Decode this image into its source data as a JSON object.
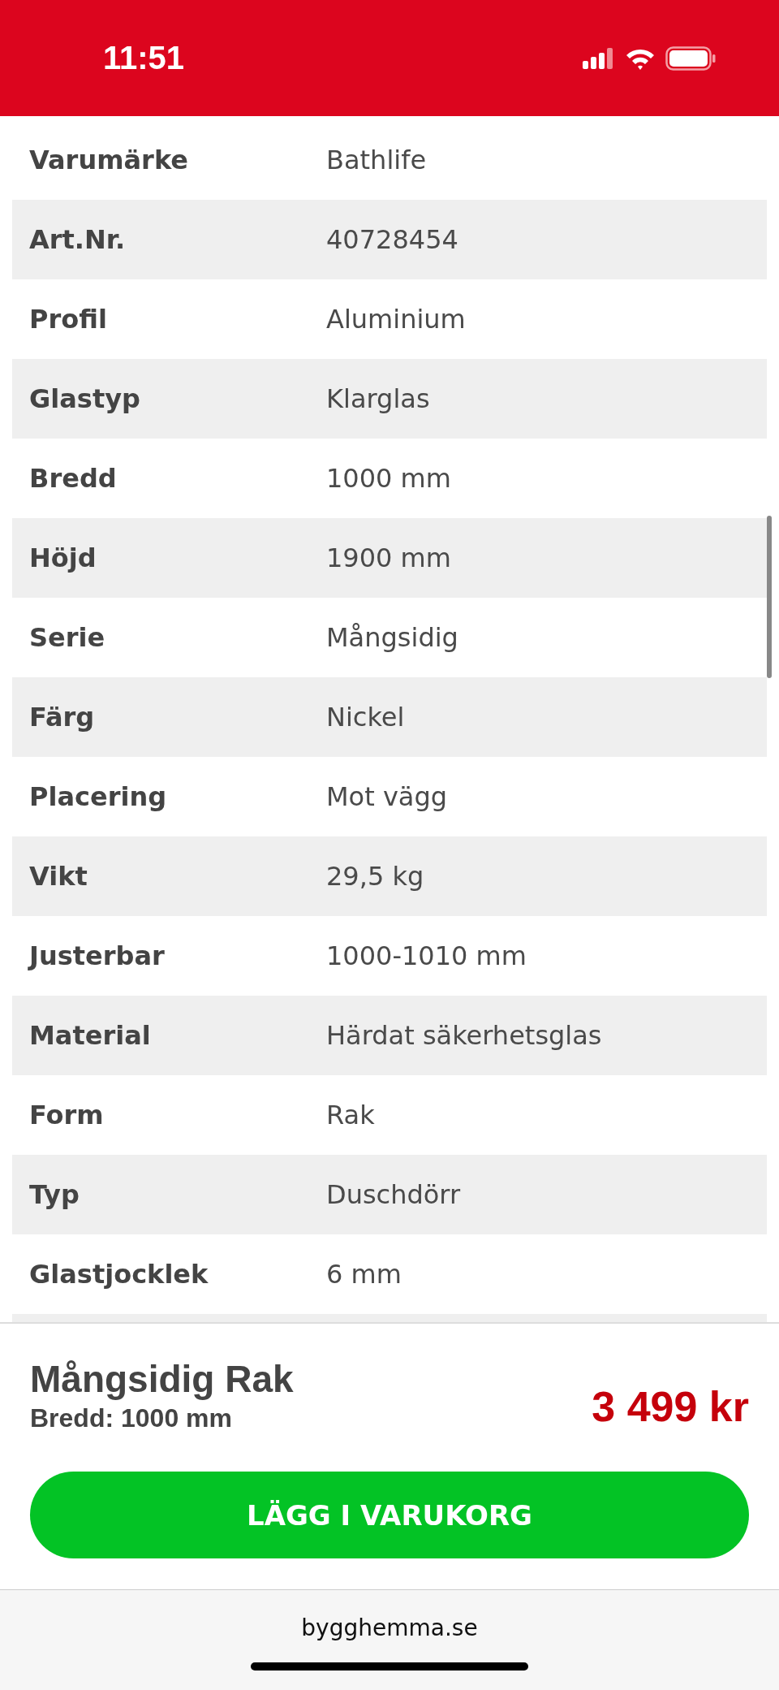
{
  "status_bar": {
    "time": "11:51"
  },
  "specs": [
    {
      "label": "Varumärke",
      "value": "Bathlife"
    },
    {
      "label": "Art.Nr.",
      "value": "40728454"
    },
    {
      "label": "Profil",
      "value": "Aluminium"
    },
    {
      "label": "Glastyp",
      "value": "Klarglas"
    },
    {
      "label": "Bredd",
      "value": "1000 mm"
    },
    {
      "label": "Höjd",
      "value": "1900 mm"
    },
    {
      "label": "Serie",
      "value": "Mångsidig"
    },
    {
      "label": "Färg",
      "value": "Nickel"
    },
    {
      "label": "Placering",
      "value": "Mot vägg"
    },
    {
      "label": "Vikt",
      "value": "29,5 kg"
    },
    {
      "label": "Justerbar",
      "value": "1000-1010 mm"
    },
    {
      "label": "Material",
      "value": "Härdat säkerhetsglas"
    },
    {
      "label": "Form",
      "value": "Rak"
    },
    {
      "label": "Typ",
      "value": "Duschdörr"
    },
    {
      "label": "Glastjocklek",
      "value": "6 mm"
    }
  ],
  "product": {
    "name": "Mångsidig Rak",
    "variant": "Bredd: 1000 mm",
    "price": "3 499 kr",
    "button": "LÄGG I VARUKORG"
  },
  "browser": {
    "address": "bygghemma.se"
  }
}
